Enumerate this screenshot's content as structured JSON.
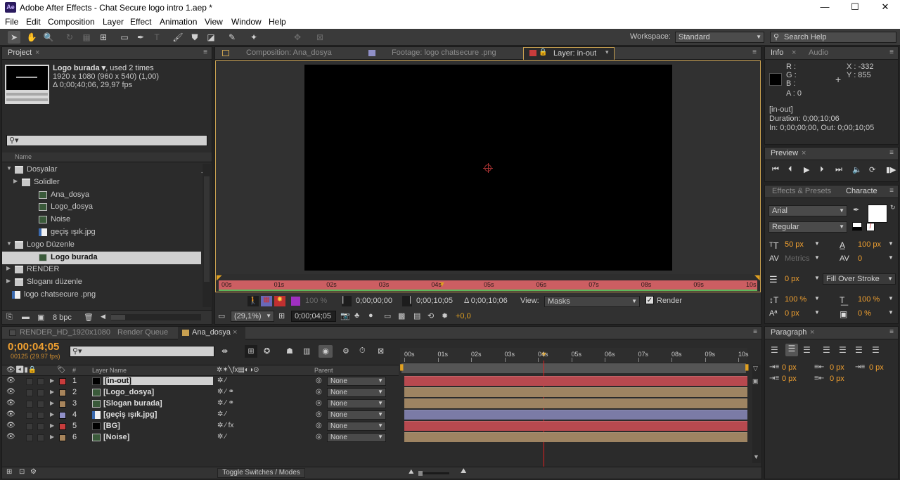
{
  "titlebar": {
    "app_icon": "Ae",
    "title": "Adobe After Effects - Chat Secure logo intro 1.aep *",
    "minimize": "—",
    "maximize": "☐",
    "close": "✕"
  },
  "menu": [
    "File",
    "Edit",
    "Composition",
    "Layer",
    "Effect",
    "Animation",
    "View",
    "Window",
    "Help"
  ],
  "workspace": {
    "label": "Workspace:",
    "value": "Standard"
  },
  "search_help": {
    "placeholder": "Search Help"
  },
  "project": {
    "tab": "Project",
    "close": "×",
    "selected_name": "Logo burada ▾",
    "used": ", used 2 times",
    "dims": "1920 x 1080  (960 x 540) (1,00)",
    "duration": "Δ 0;00;40;06, 29,97 fps",
    "column_name": "Name",
    "bpc": "8 bpc",
    "items": [
      {
        "label": "Dosyalar",
        "type": "folder",
        "indent": 0,
        "expanded": true
      },
      {
        "label": "Solidler",
        "type": "folder",
        "indent": 1,
        "expanded": false
      },
      {
        "label": "Ana_dosya",
        "type": "comp",
        "indent": 2
      },
      {
        "label": "Logo_dosya",
        "type": "comp",
        "indent": 2
      },
      {
        "label": "Noise",
        "type": "comp",
        "indent": 2
      },
      {
        "label": "geçiş ışık.jpg",
        "type": "file",
        "indent": 2
      },
      {
        "label": "Logo Düzenle",
        "type": "folder",
        "indent": 0,
        "expanded": true
      },
      {
        "label": "Logo burada",
        "type": "comp",
        "indent": 2,
        "selected": true
      },
      {
        "label": "RENDER",
        "type": "folder",
        "indent": 0,
        "expanded": false
      },
      {
        "label": "Sloganı düzenle",
        "type": "folder",
        "indent": 0,
        "expanded": false
      },
      {
        "label": "logo chatsecure .png",
        "type": "file",
        "indent": 0
      }
    ]
  },
  "viewer": {
    "tabs": [
      "Composition: Ana_dosya",
      "Footage: logo chatsecure .png",
      "Layer: in-out"
    ],
    "ruler": [
      "00s",
      "01s",
      "02s",
      "03s",
      "04s",
      "05s",
      "06s",
      "07s",
      "08s",
      "09s",
      "10s"
    ],
    "in_time": "0;00;00;00",
    "out_time": "0;00;10;05",
    "duration": "Δ 0;00;10;06",
    "view_label": "View:",
    "view_value": "Masks",
    "render_label": "Render",
    "zoom": "(29,1%)",
    "current_time": "0;00;04;05",
    "exposure": "+0,0",
    "pct": "100 %"
  },
  "info": {
    "tabs": [
      "Info",
      "Audio"
    ],
    "r": "R :",
    "g": "G :",
    "b": "B :",
    "a": "A : 0",
    "x": "X : -332",
    "y": "Y : 855",
    "layer": "[in-out]",
    "duration": "Duration: 0;00;10;06",
    "inout": "In: 0;00;00;00, Out: 0;00;10;05"
  },
  "preview": {
    "tab": "Preview"
  },
  "character": {
    "tabs": [
      "Effects & Presets",
      "Characte"
    ],
    "font": "Arial",
    "style": "Regular",
    "size": "50 px",
    "leading": "100 px",
    "kerning": "Metrics",
    "tracking": "0",
    "stroke_width": "0 px",
    "stroke_mode": "Fill Over Stroke",
    "vscale": "100 %",
    "hscale": "100 %",
    "baseline": "0 px",
    "tsume": "0 %"
  },
  "paragraph": {
    "tab": "Paragraph",
    "indent1": "0 px",
    "indent2": "0 px",
    "indent3": "0 px",
    "space1": "0 px",
    "space2": "0 px"
  },
  "timeline": {
    "tabs": [
      "RENDER_HD_1920x1080",
      "Render Queue",
      "Ana_dosya"
    ],
    "time": "0;00;04;05",
    "frames": "00125 (29.97 fps)",
    "col_layer": "Layer Name",
    "col_parent": "Parent",
    "col_num": "#",
    "ruler": [
      "00s",
      "01s",
      "02s",
      "03s",
      "04s",
      "05s",
      "06s",
      "07s",
      "08s",
      "09s",
      "10s"
    ],
    "toggle": "Toggle Switches / Modes",
    "layers": [
      {
        "num": "1",
        "name": "[in-out]",
        "color": "#c83c3c",
        "src": "#000000",
        "parent": "None",
        "bar": "#b8494f",
        "selected": true
      },
      {
        "num": "2",
        "name": "[Logo_dosya]",
        "color": "#a8855c",
        "src": "comp",
        "parent": "None",
        "bar": "#9e8462"
      },
      {
        "num": "3",
        "name": "[Slogan burada]",
        "color": "#a8855c",
        "src": "comp",
        "parent": "None",
        "bar": "#9e8462"
      },
      {
        "num": "4",
        "name": "[geçiş ışık.jpg]",
        "color": "#9090c8",
        "src": "file",
        "parent": "None",
        "bar": "#7b7ba6"
      },
      {
        "num": "5",
        "name": "[BG]",
        "color": "#c83c3c",
        "src": "#000000",
        "parent": "None",
        "bar": "#b8494f"
      },
      {
        "num": "6",
        "name": "[Noise]",
        "color": "#a8855c",
        "src": "comp",
        "parent": "None",
        "bar": "#9e8462"
      }
    ]
  }
}
